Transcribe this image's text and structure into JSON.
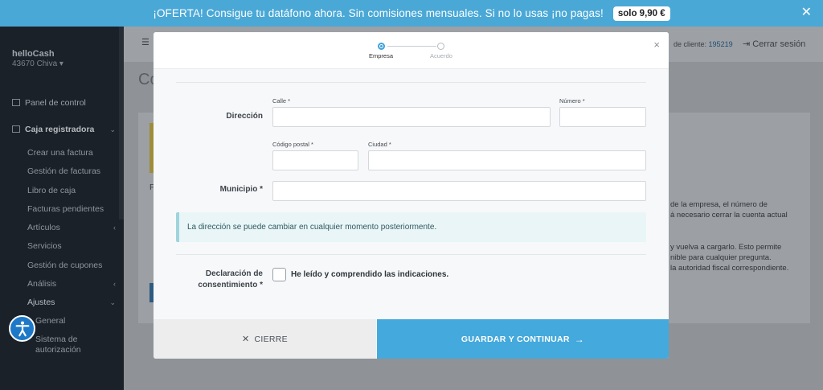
{
  "promo": {
    "text": "¡OFERTA! Consigue tu datáfono ahora. Sin comisiones mensuales. Si no lo usas ¡no pagas!",
    "badge": "solo 9,90 €"
  },
  "sidebar": {
    "brand": "helloCash",
    "location": "43670 Chiva ▾",
    "dashboard": "Panel de control",
    "register": "Caja registradora",
    "items": [
      "Crear una factura",
      "Gestión de facturas",
      "Libro de caja",
      "Facturas pendientes",
      "Artículos",
      "Servicios",
      "Gestión de cupones",
      "Análisis",
      "Ajustes"
    ],
    "sub_general": "General",
    "sub_auth": "Sistema de autorización"
  },
  "topbar": {
    "client_label": "de cliente:",
    "client_number": "195219",
    "logout": "Cerrar sesión"
  },
  "background": {
    "title": "Co",
    "letter": "F",
    "text1": "de la empresa, el número de",
    "text2": "á necesario cerrar la cuenta actual",
    "text3": "y vuelva a cargarlo. Esto permite",
    "text4": "nible para cualquier pregunta.",
    "text5": "la autoridad fiscal correspondiente."
  },
  "modal": {
    "steps": [
      "Empresa",
      "Acuerdo"
    ],
    "address_label": "Dirección",
    "street_label": "Calle *",
    "number_label": "Número *",
    "postal_label": "Código postal *",
    "city_label": "Ciudad *",
    "municipality_label": "Municipio *",
    "info": "La dirección se puede cambiar en cualquier momento posteriormente.",
    "consent_label": "Declaración de consentimiento *",
    "consent_text": "He leído y comprendido las indicaciones.",
    "close_button": "CIERRE",
    "save_button": "GUARDAR Y CONTINUAR"
  },
  "colors": {
    "accent": "#44a9dc",
    "promo": "#4aa8d6",
    "info_bg": "#e9f5f6"
  }
}
